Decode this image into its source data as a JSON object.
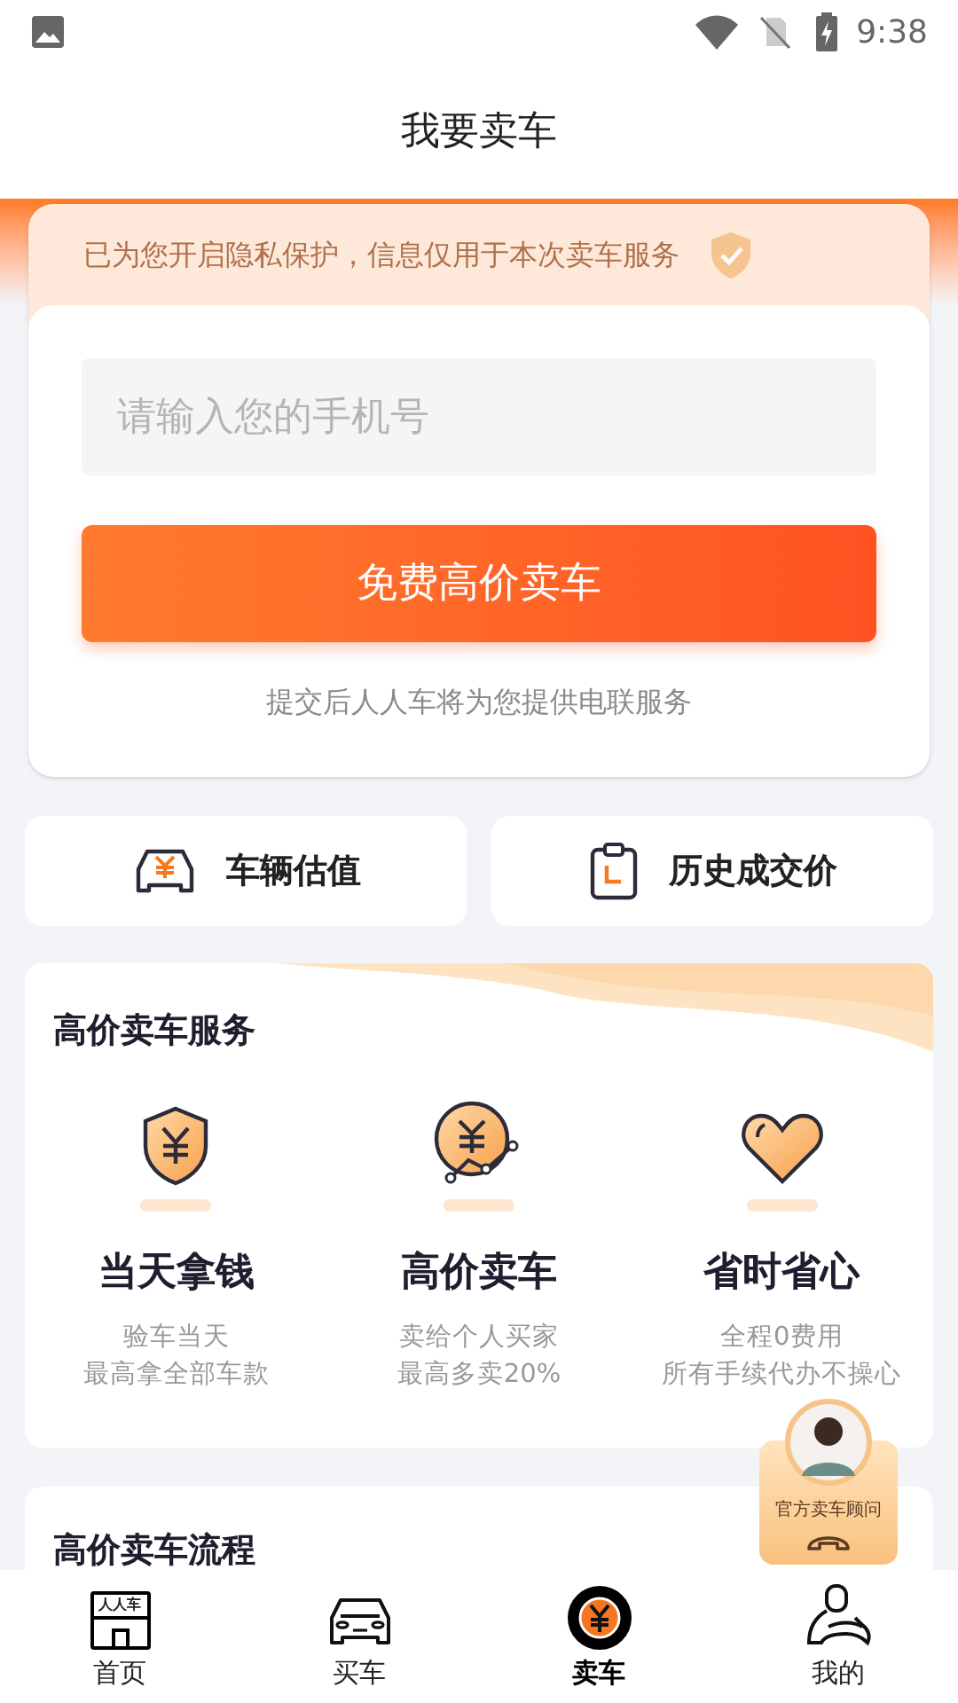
{
  "status_bar": {
    "time": "9:38"
  },
  "title": "我要卖车",
  "privacy_notice": "已为您开启隐私保护，信息仅用于本次卖车服务",
  "phone_field": {
    "placeholder": "请输入您的手机号"
  },
  "submit_button": "免费高价卖车",
  "submit_note": "提交后人人车将为您提供电联服务",
  "quick_actions": [
    {
      "kind": "valuation",
      "label": "车辆估值"
    },
    {
      "kind": "history",
      "label": "历史成交价"
    }
  ],
  "services": {
    "title": "高价卖车服务",
    "items": [
      {
        "kind": "shield",
        "title": "当天拿钱",
        "lines": [
          "验车当天",
          "最高拿全部车款"
        ]
      },
      {
        "kind": "chart",
        "title": "高价卖车",
        "lines": [
          "卖给个人买家",
          "最高多卖20%"
        ]
      },
      {
        "kind": "heart",
        "title": "省时省心",
        "lines": [
          "全程0费用",
          "所有手续代办不操心"
        ]
      }
    ]
  },
  "process": {
    "title": "高价卖车流程"
  },
  "advisor": {
    "label": "官方卖车顾问"
  },
  "bottom_nav": [
    {
      "kind": "home",
      "label": "首页",
      "logo_text": "人人车",
      "selected": false
    },
    {
      "kind": "buy",
      "label": "买车",
      "selected": false
    },
    {
      "kind": "sell",
      "label": "卖车",
      "selected": true
    },
    {
      "kind": "me",
      "label": "我的",
      "selected": false
    }
  ]
}
